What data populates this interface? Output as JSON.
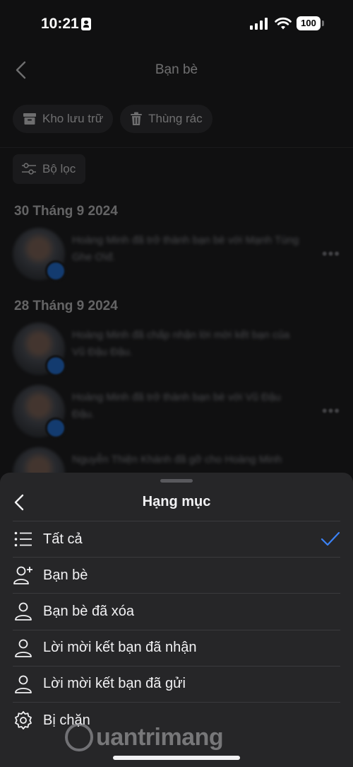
{
  "status_bar": {
    "time": "10:21",
    "battery": "100"
  },
  "page": {
    "title": "Bạn bè",
    "chips": [
      {
        "label": "Kho lưu trữ",
        "icon": "archive-icon"
      },
      {
        "label": "Thùng rác",
        "icon": "trash-icon"
      }
    ],
    "filter_label": "Bộ lọc",
    "sections": [
      {
        "date": "30 Tháng 9 2024",
        "items": [
          {
            "text": "Hoàng Minh đã trở thành bạn bè với Mạnh Tùng Ghe Ơiđ."
          }
        ]
      },
      {
        "date": "28 Tháng 9 2024",
        "items": [
          {
            "text": "Hoàng Minh đã chấp nhận lời mời kết bạn của Vũ Đậu Đậu."
          },
          {
            "text": "Hoàng Minh đã trở thành bạn bè với Vũ Đậu Đậu."
          },
          {
            "text": "Nguyễn Thiện Khánh đã gỡ cho Hoàng Minh"
          }
        ]
      }
    ]
  },
  "sheet": {
    "title": "Hạng mục",
    "items": [
      {
        "label": "Tất cả",
        "icon": "list-icon",
        "selected": true
      },
      {
        "label": "Bạn bè",
        "icon": "person-add-icon",
        "selected": false
      },
      {
        "label": "Bạn bè đã xóa",
        "icon": "person-icon",
        "selected": false
      },
      {
        "label": "Lời mời kết bạn đã nhận",
        "icon": "person-icon",
        "selected": false
      },
      {
        "label": "Lời mời kết bạn đã gửi",
        "icon": "person-icon",
        "selected": false
      },
      {
        "label": "Bị chặn",
        "icon": "gear-icon",
        "selected": false
      }
    ],
    "accent_color": "#3b82f6"
  },
  "watermark": {
    "text": "uantrimang"
  }
}
